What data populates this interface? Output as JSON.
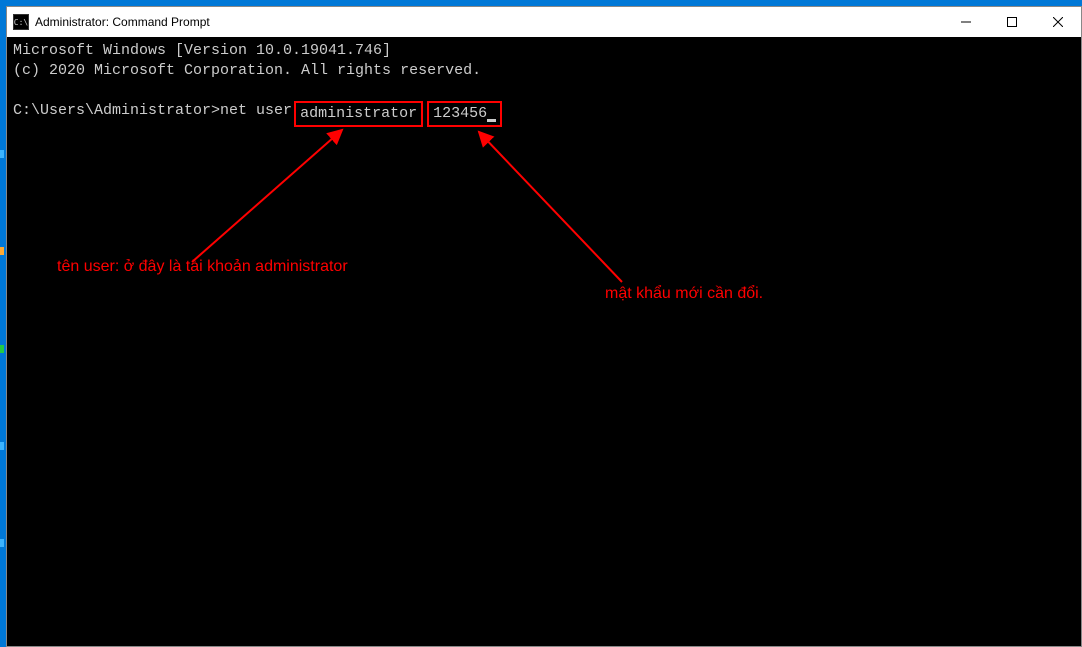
{
  "window": {
    "title": "Administrator: Command Prompt",
    "icon_label": "C:\\"
  },
  "terminal": {
    "line1": "Microsoft Windows [Version 10.0.19041.746]",
    "line2": "(c) 2020 Microsoft Corporation. All rights reserved.",
    "prompt": "C:\\Users\\Administrator>",
    "command_prefix": "net user",
    "username_arg": "administrator",
    "password_arg": "123456"
  },
  "annotations": {
    "left_label": "tên user: ở đây là tài khoản administrator",
    "right_label": "mật khẩu mới cần đổi."
  },
  "colors": {
    "accent_red": "#ff0000",
    "titlebar_blue": "#0078d7"
  }
}
